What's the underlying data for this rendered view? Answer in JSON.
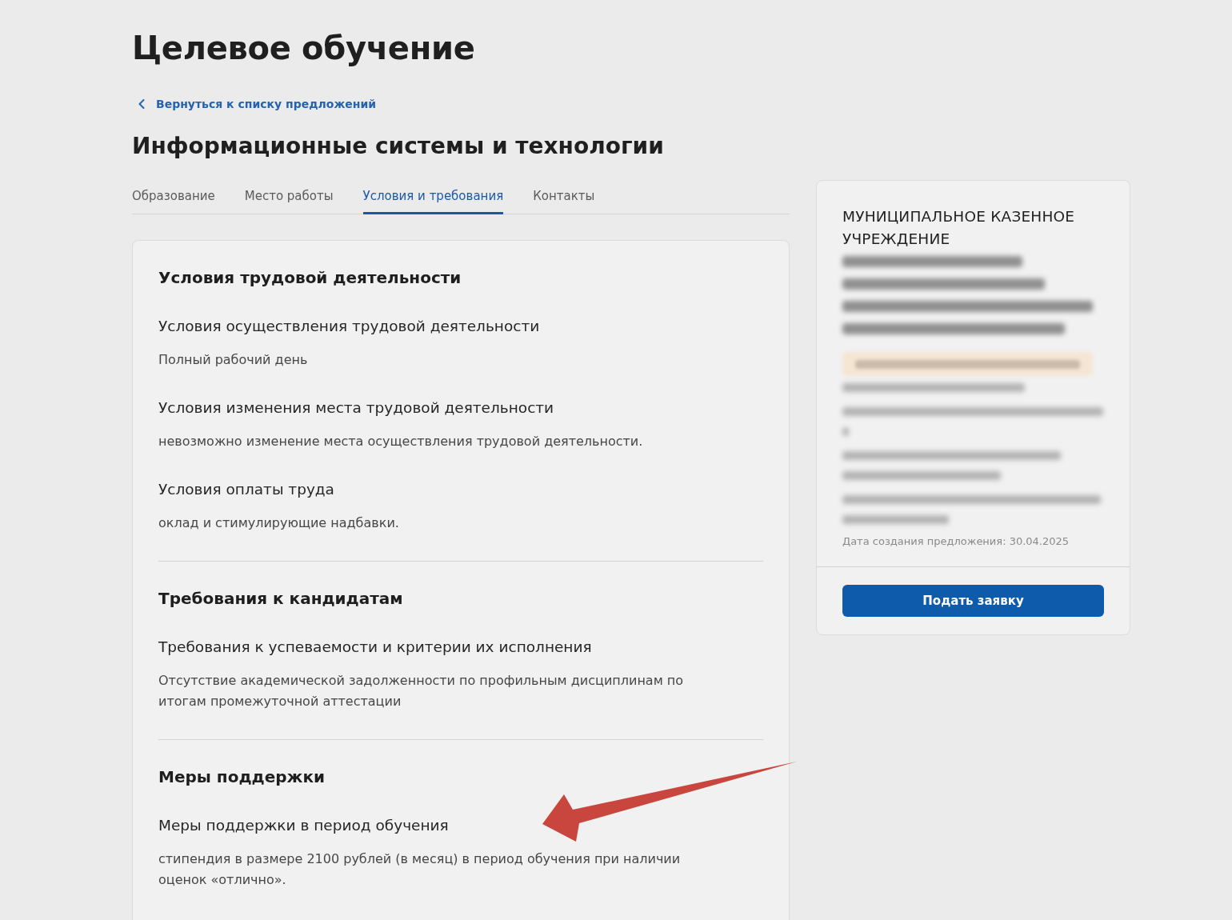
{
  "page_title": "Целевое обучение",
  "back_link": {
    "label": "Вернуться к списку предложений"
  },
  "offer_title": "Информационные системы и технологии",
  "tabs": [
    {
      "label": "Образование",
      "selected": false
    },
    {
      "label": "Место работы",
      "selected": false
    },
    {
      "label": "Условия и требования",
      "selected": true
    },
    {
      "label": "Контакты",
      "selected": false
    }
  ],
  "sections": [
    {
      "title": "Условия трудовой деятельности",
      "items": [
        {
          "label": "Условия осуществления трудовой деятельности",
          "value": "Полный рабочий день"
        },
        {
          "label": "Условия изменения места трудовой деятельности",
          "value": "невозможно изменение места осуществления трудовой деятельности."
        },
        {
          "label": "Условия оплаты труда",
          "value": "оклад и стимулирующие надбавки."
        }
      ]
    },
    {
      "title": "Требования к кандидатам",
      "items": [
        {
          "label": "Требования к успеваемости и критерии их исполнения",
          "value": "Отсутствие академической задолженности по профильным дисциплинам по итогам промежуточной аттестации"
        }
      ]
    },
    {
      "title": "Меры поддержки",
      "items": [
        {
          "label": "Меры поддержки в период обучения",
          "value": "стипендия в размере 2100 рублей (в месяц) в период обучения при наличии оценок «отлично»."
        }
      ]
    }
  ],
  "offer_card": {
    "organization": "МУНИЦИПАЛЬНОЕ КАЗЕННОЕ УЧРЕЖДЕНИЕ",
    "blurred": [
      {
        "kind": "name-line"
      },
      {
        "kind": "name-line"
      },
      {
        "kind": "name-line"
      },
      {
        "kind": "name-line"
      },
      {
        "kind": "badge"
      },
      {
        "kind": "line"
      },
      {
        "kind": "line"
      },
      {
        "kind": "wrap"
      },
      {
        "kind": "line"
      },
      {
        "kind": "wrap"
      },
      {
        "kind": "line"
      },
      {
        "kind": "wrap"
      }
    ],
    "created": "Дата создания предложения: 30.04.2025",
    "button": "Подать заявку"
  },
  "annotations": [
    {
      "kind": "arrow"
    }
  ]
}
